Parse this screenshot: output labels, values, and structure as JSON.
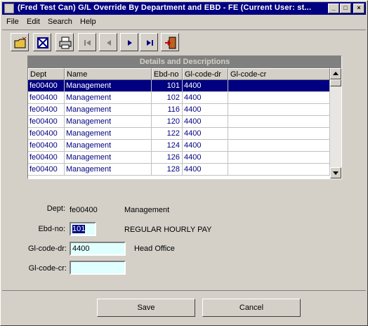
{
  "window": {
    "title": "(Fred Test Can) G/L Override By Department and EBD - FE (Current User: st...",
    "minimize_glyph": "_",
    "maximize_glyph": "□",
    "close_glyph": "×"
  },
  "menu": [
    "File",
    "Edit",
    "Search",
    "Help"
  ],
  "grid": {
    "caption": "Details and Descriptions",
    "columns": [
      "Dept",
      "Name",
      "Ebd-no",
      "Gl-code-dr",
      "Gl-code-cr"
    ],
    "rows": [
      {
        "dept": "fe00400",
        "name": "Management",
        "ebd": "101",
        "dr": "4400",
        "cr": ""
      },
      {
        "dept": "fe00400",
        "name": "Management",
        "ebd": "102",
        "dr": "4400",
        "cr": ""
      },
      {
        "dept": "fe00400",
        "name": "Management",
        "ebd": "116",
        "dr": "4400",
        "cr": ""
      },
      {
        "dept": "fe00400",
        "name": "Management",
        "ebd": "120",
        "dr": "4400",
        "cr": ""
      },
      {
        "dept": "fe00400",
        "name": "Management",
        "ebd": "122",
        "dr": "4400",
        "cr": ""
      },
      {
        "dept": "fe00400",
        "name": "Management",
        "ebd": "124",
        "dr": "4400",
        "cr": ""
      },
      {
        "dept": "fe00400",
        "name": "Management",
        "ebd": "126",
        "dr": "4400",
        "cr": ""
      },
      {
        "dept": "fe00400",
        "name": "Management",
        "ebd": "128",
        "dr": "4400",
        "cr": ""
      }
    ]
  },
  "form": {
    "dept_label": "Dept:",
    "dept_value": "fe00400",
    "dept_desc": "Management",
    "ebd_label": "Ebd-no:",
    "ebd_value": "101",
    "ebd_desc": "REGULAR HOURLY PAY",
    "gldr_label": "Gl-code-dr:",
    "gldr_value": "4400",
    "gldr_desc": "Head Office",
    "glcr_label": "Gl-code-cr:",
    "glcr_value": ""
  },
  "buttons": {
    "save": "Save",
    "cancel": "Cancel"
  },
  "colors": {
    "title_bar": "#000080",
    "selection": "#000080",
    "field_bg": "#e0ffff",
    "dialog_bg": "#d4d0c8"
  }
}
